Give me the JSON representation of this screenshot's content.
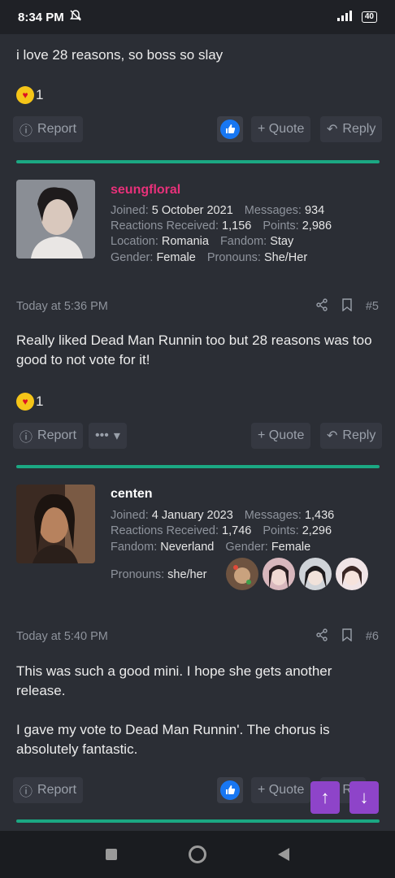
{
  "status": {
    "time": "8:34 PM",
    "battery": "40"
  },
  "posts": [
    {
      "body": [
        "i love 28 reasons, so boss so slay"
      ],
      "reaction_count": "1",
      "actions": {
        "report": "Report",
        "quote": "+ Quote",
        "reply": "Reply"
      }
    },
    {
      "user": {
        "name": "seungfloral",
        "name_color": "#e8317a",
        "joined_label": "Joined:",
        "joined": "5 October 2021",
        "messages_label": "Messages:",
        "messages": "934",
        "reactions_label": "Reactions Received:",
        "reactions": "1,156",
        "points_label": "Points:",
        "points": "2,986",
        "location_label": "Location:",
        "location": "Romania",
        "fandom_label": "Fandom:",
        "fandom": "Stay",
        "gender_label": "Gender:",
        "gender": "Female",
        "pronouns_label": "Pronouns:",
        "pronouns": "She/Her"
      },
      "timestamp": "Today at 5:36 PM",
      "number": "#5",
      "body": [
        "Really liked Dead Man Runnin too but 28 reasons was too good to not vote for it!"
      ],
      "reaction_count": "1",
      "actions": {
        "report": "Report",
        "more": "•••",
        "quote": "+ Quote",
        "reply": "Reply"
      }
    },
    {
      "user": {
        "name": "centen",
        "name_color": "#ffffff",
        "joined_label": "Joined:",
        "joined": "4 January 2023",
        "messages_label": "Messages:",
        "messages": "1,436",
        "reactions_label": "Reactions Received:",
        "reactions": "1,746",
        "points_label": "Points:",
        "points": "2,296",
        "fandom_label": "Fandom:",
        "fandom": "Neverland",
        "gender_label": "Gender:",
        "gender": "Female",
        "pronouns_label": "Pronouns:",
        "pronouns": "she/her"
      },
      "timestamp": "Today at 5:40 PM",
      "number": "#6",
      "body": [
        "This was such a good mini. I hope she gets another release.",
        "I gave my vote to Dead Man Runnin'. The chorus is absolutely fantastic."
      ],
      "actions": {
        "report": "Report",
        "quote": "+ Quote",
        "reply": "Re"
      }
    }
  ],
  "colors": {
    "accent_divider": "#1ba883",
    "fab": "#8e44c9",
    "like": "#1877f2"
  }
}
